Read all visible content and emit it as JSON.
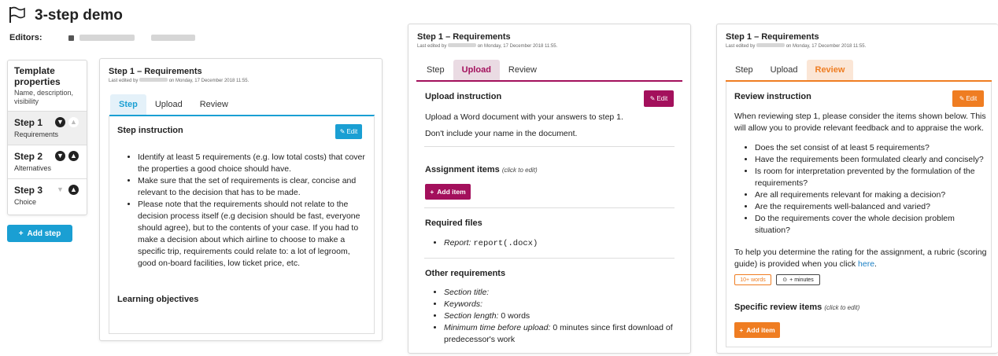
{
  "header": {
    "title": "3-step demo",
    "editors_label": "Editors:",
    "flag_icon": "flag-icon"
  },
  "template": {
    "title": "Template properties",
    "subtitle": "Name, description, visibility",
    "steps": [
      {
        "name": "Step 1",
        "desc": "Requirements"
      },
      {
        "name": "Step 2",
        "desc": "Alternatives"
      },
      {
        "name": "Step 3",
        "desc": "Choice"
      }
    ],
    "add_step_label": "Add step"
  },
  "panel1": {
    "title": "Step 1 – Requirements",
    "sub_prefix": "Last edited by",
    "sub_suffix": "on Monday, 17 December 2018 11:55.",
    "tabs": [
      "Step",
      "Upload",
      "Review"
    ],
    "section_title": "Step instruction",
    "edit_label": "Edit",
    "bullets": [
      "Identify at least 5 requirements (e.g. low total costs) that cover the properties a good choice should have.",
      "Make sure that the set of requirements is clear, concise and relevant to the decision that has to be made.",
      "Please note that the requirements should not relate to the decision process itself (e.g decision should be fast, everyone should agree), but to the contents of your case. If you had to make a decision about which airline to choose to make a specific trip, requirements could relate to: a lot of legroom, good on-board facilities, low ticket price, etc."
    ],
    "learning_title": "Learning objectives",
    "accent": "#1a9fd3"
  },
  "panel2": {
    "title": "Step 1 – Requirements",
    "sub_prefix": "Last edited by",
    "sub_suffix": "on Monday, 17 December 2018 11:55.",
    "tabs": [
      "Step",
      "Upload",
      "Review"
    ],
    "section_title": "Upload instruction",
    "edit_label": "Edit",
    "text1": "Upload a Word document with your answers to step 1.",
    "text2": "Don't include your name in the document.",
    "assignment_title": "Assignment items",
    "assignment_hint": "(click to edit)",
    "add_item_label": "Add item",
    "required_title": "Required files",
    "required_item_label": "Report:",
    "required_item_value": "report(.docx)",
    "other_title": "Other requirements",
    "other_items": [
      {
        "label": "Section title:",
        "value": ""
      },
      {
        "label": "Keywords:",
        "value": ""
      },
      {
        "label": "Section length:",
        "value": "0 words"
      },
      {
        "label": "Minimum time before upload:",
        "value": "0 minutes since first download of predecessor's work"
      }
    ],
    "accent": "#a3105c"
  },
  "panel3": {
    "title": "Step 1 – Requirements",
    "sub_prefix": "Last edited by",
    "sub_suffix": "on Monday, 17 December 2018 11:55.",
    "tabs": [
      "Step",
      "Upload",
      "Review"
    ],
    "section_title": "Review instruction",
    "edit_label": "Edit",
    "intro": "When reviewing step 1, please consider the items shown below. This will allow you to provide relevant feedback and to appraise the work.",
    "bullets": [
      "Does the set consist of at least 5 requirements?",
      "Have the requirements been formulated clearly and concisely?",
      "Is room for interpretation prevented by the formulation of the requirements?",
      "Are all requirements relevant for making a decision?",
      "Are the requirements well-balanced and varied?",
      "Do the requirements cover the whole decision problem situation?"
    ],
    "rubric_text": "To help you determine the rating for the assignment, a rubric (scoring guide) is provided when you click",
    "rubric_link": "here",
    "rubric_end": ".",
    "badge_words": "10+ words",
    "badge_minutes": "+ minutes",
    "specific_title": "Specific review items",
    "specific_hint": "(click to edit)",
    "add_item_label": "Add item",
    "accent": "#ef7d22"
  }
}
